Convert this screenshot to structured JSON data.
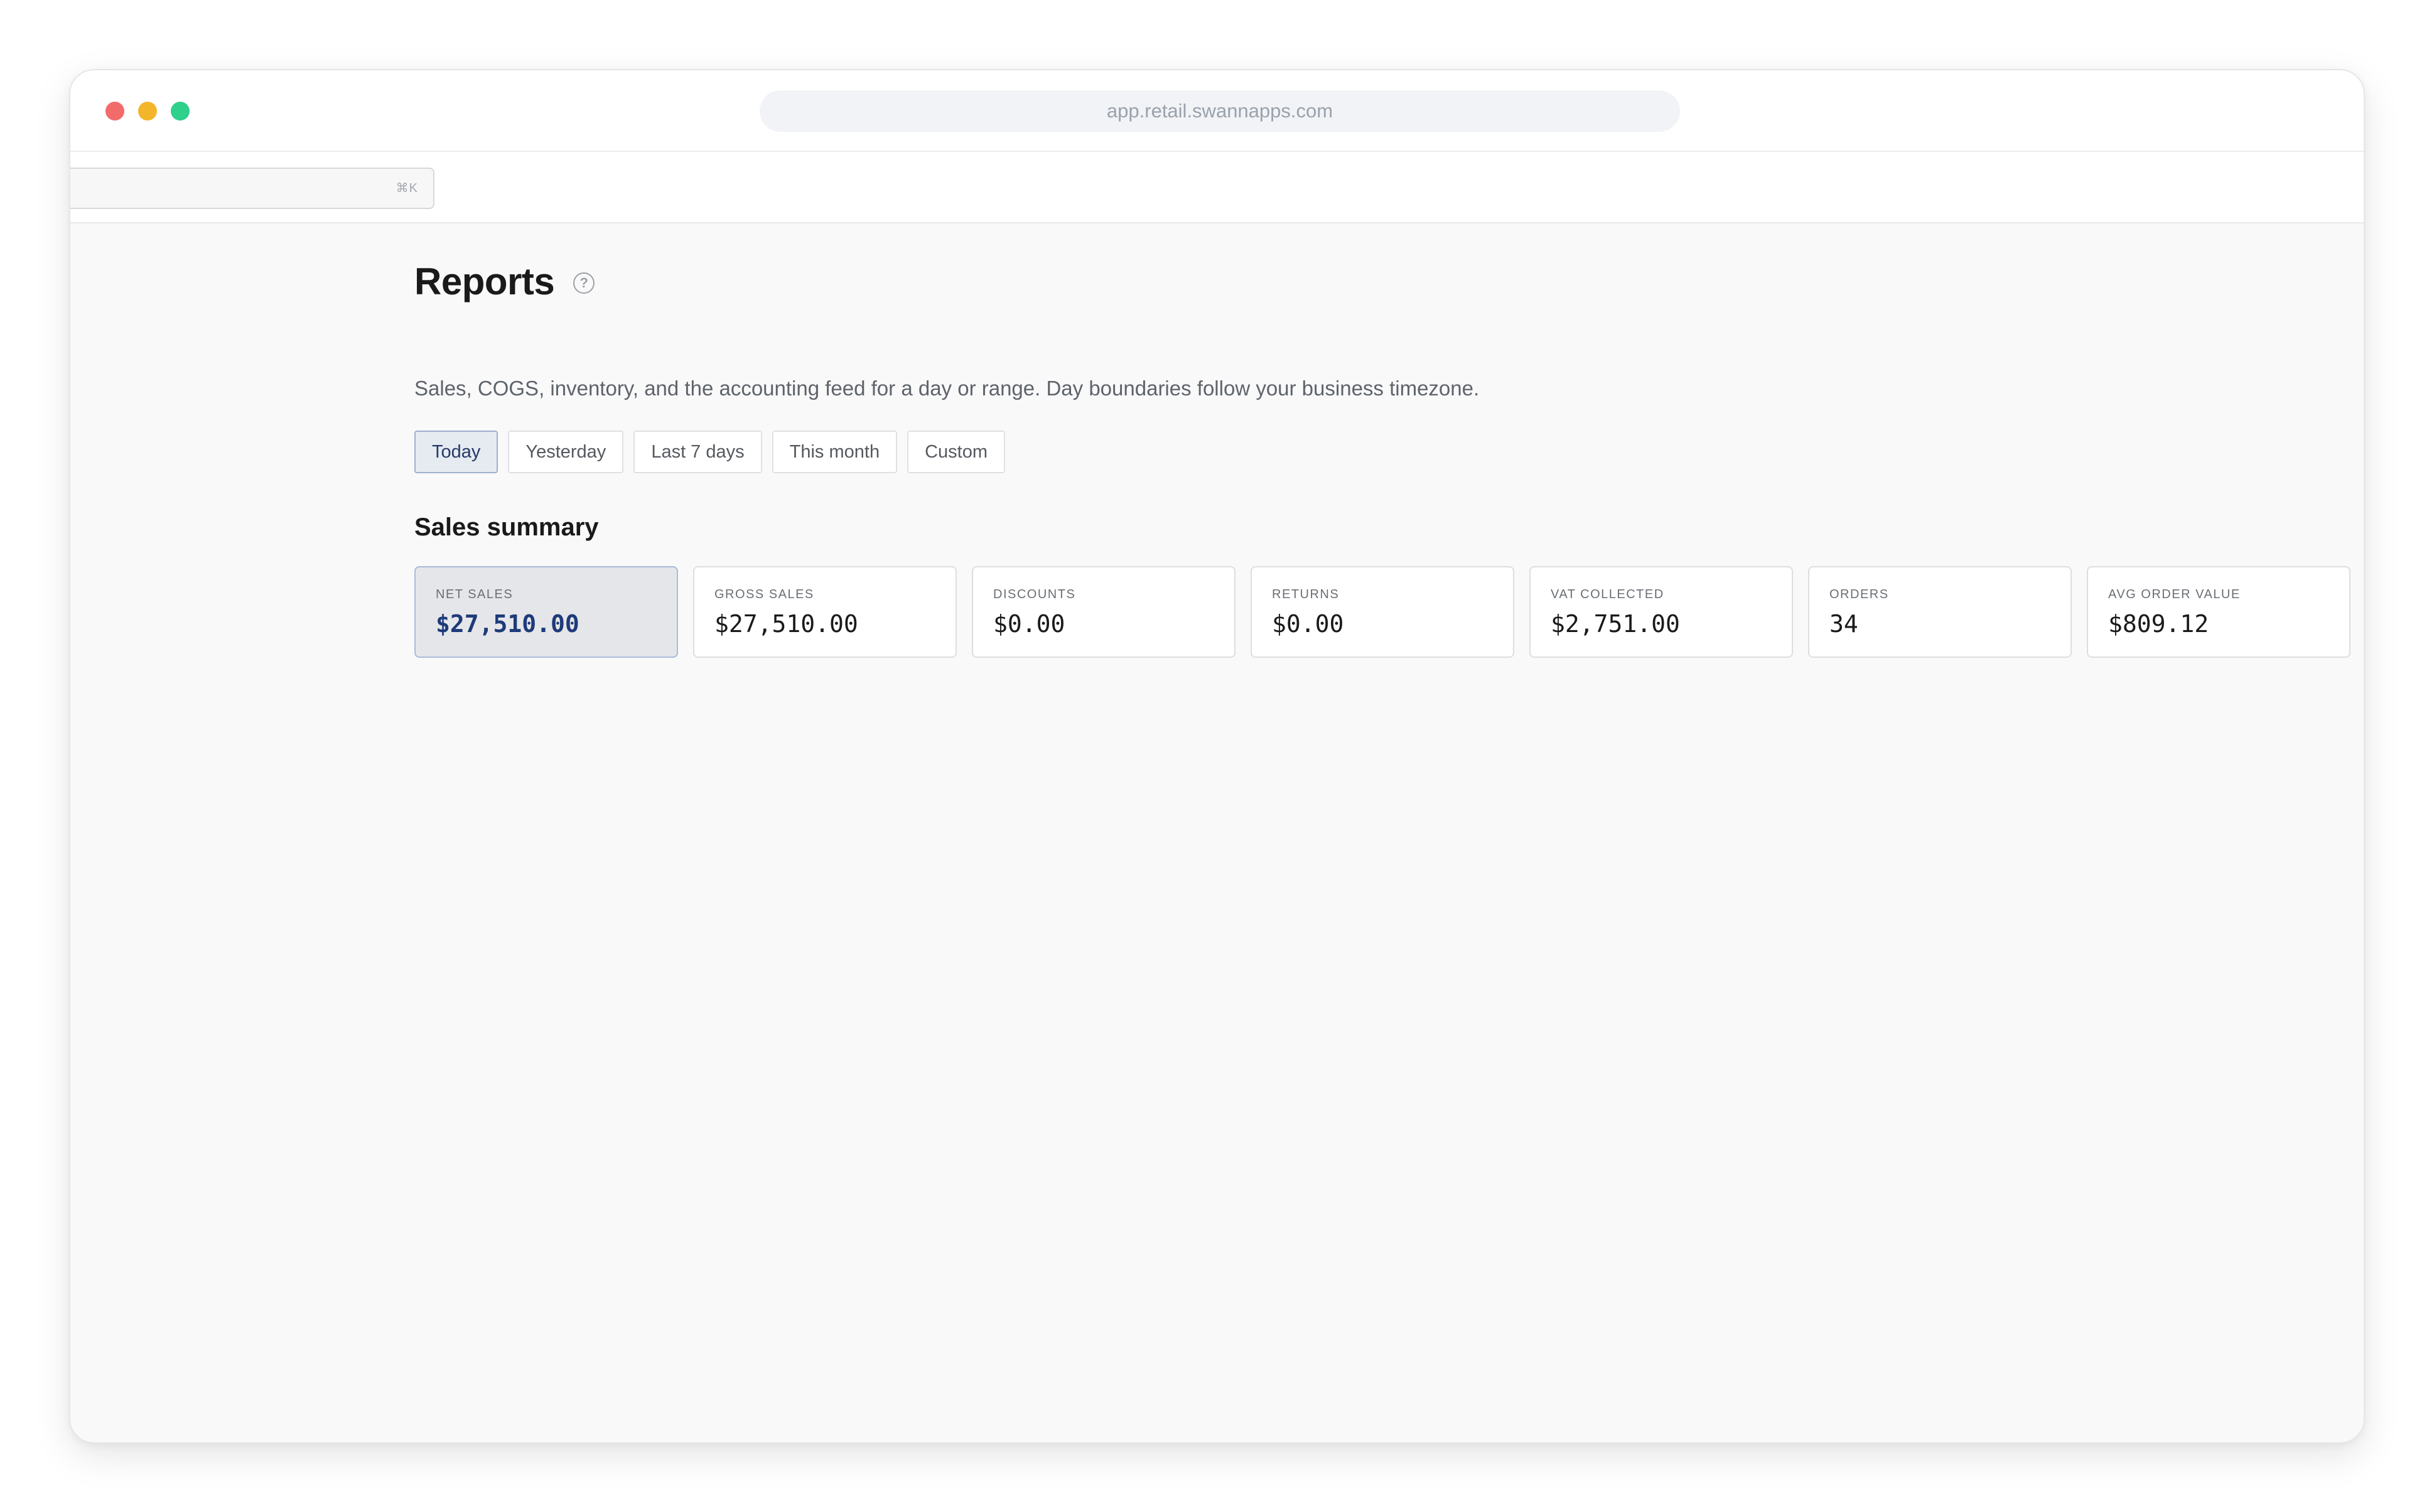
{
  "browser": {
    "url": "app.retail.swannapps.com"
  },
  "search": {
    "shortcut": "⌘K"
  },
  "page": {
    "title": "Reports",
    "help_icon": "?",
    "subtitle": "Sales, COGS, inventory, and the accounting feed for a day or range. Day boundaries follow your business timezone."
  },
  "range_tabs": [
    {
      "label": "Today",
      "active": true
    },
    {
      "label": "Yesterday",
      "active": false
    },
    {
      "label": "Last 7 days",
      "active": false
    },
    {
      "label": "This month",
      "active": false
    },
    {
      "label": "Custom",
      "active": false
    }
  ],
  "sales_summary": {
    "title": "Sales summary",
    "cards": [
      {
        "label": "NET SALES",
        "value": "$27,510.00",
        "active": true
      },
      {
        "label": "GROSS SALES",
        "value": "$27,510.00",
        "active": false
      },
      {
        "label": "DISCOUNTS",
        "value": "$0.00",
        "active": false
      },
      {
        "label": "RETURNS",
        "value": "$0.00",
        "active": false
      },
      {
        "label": "VAT COLLECTED",
        "value": "$2,751.00",
        "active": false
      },
      {
        "label": "ORDERS",
        "value": "34",
        "active": false
      },
      {
        "label": "AVG ORDER VALUE",
        "value": "$809.12",
        "active": false
      }
    ]
  },
  "colors": {
    "accent": "#243a66",
    "active_tab_bg": "#e6ebf2",
    "active_value": "#1e3a7a",
    "traffic_red": "#f26b6b",
    "traffic_yellow": "#f3b52a",
    "traffic_green": "#2fcf8c"
  },
  "icons": {
    "help": "help-circle-icon",
    "window_close": "close-dot-icon",
    "window_minimize": "minimize-dot-icon",
    "window_zoom": "zoom-dot-icon"
  }
}
